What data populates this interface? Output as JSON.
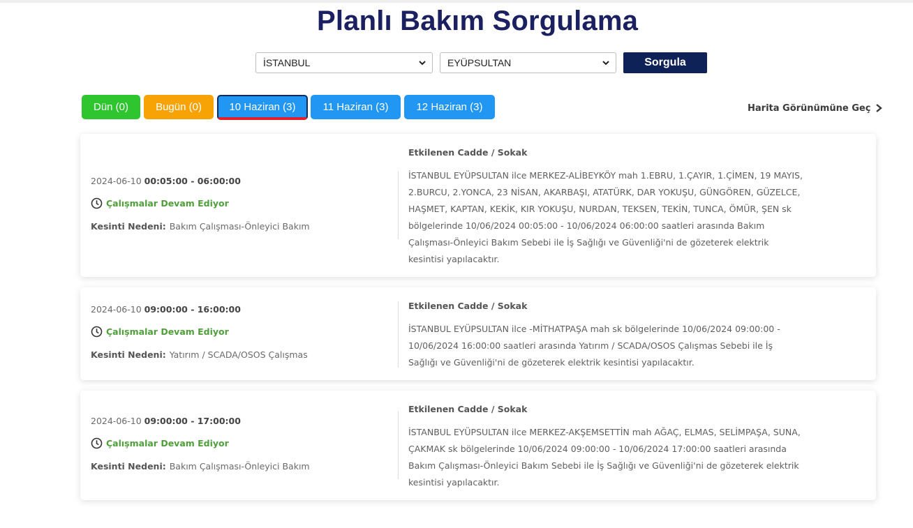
{
  "page": {
    "title": "Planlı Bakım Sorgulama"
  },
  "filters": {
    "city": "İSTANBUL",
    "district": "EYÜPSULTAN",
    "query_button": "Sorgula"
  },
  "tabs": [
    {
      "label": "Dün (0)"
    },
    {
      "label": "Bugün (0)"
    },
    {
      "label": "10 Haziran (3)"
    },
    {
      "label": "11 Haziran (3)"
    },
    {
      "label": "12 Haziran (3)"
    }
  ],
  "map_link": "Harita Görünümüne Geç",
  "outages": [
    {
      "date": "2024-06-10",
      "time_range": "00:05:00 - 06:00:00",
      "status": "Çalışmalar Devam Ediyor",
      "reason_label": "Kesinti Nedeni:",
      "reason": "Bakım Çalışması-Önleyici Bakım",
      "affected_label": "Etkilenen Cadde / Sokak",
      "affected_text": "İSTANBUL EYÜPSULTAN ilce MERKEZ-ALİBEYKÖY mah 1.EBRU, 1.ÇAYIR, 1.ÇİMEN, 19 MAYIS, 2.BURCU, 2.YONCA, 23 NİSAN, AKARBAŞI, ATATÜRK, DAR YOKUŞU, GÜNGÖREN, GÜZELCE, HAŞMET, KAPTAN, KEKİK, KIR YOKUŞU, NURDAN, TEKSEN, TEKİN, TUNCA, ÖMÜR, ŞEN sk bölgelerinde 10/06/2024 00:05:00 - 10/06/2024 06:00:00 saatleri arasında Bakım Çalışması-Önleyici Bakım Sebebi ile İş Sağlığı ve Güvenliği'ni de gözeterek elektrik kesintisi yapılacaktır."
    },
    {
      "date": "2024-06-10",
      "time_range": "09:00:00 - 16:00:00",
      "status": "Çalışmalar Devam Ediyor",
      "reason_label": "Kesinti Nedeni:",
      "reason": "Yatırım / SCADA/OSOS Çalışmas",
      "affected_label": "Etkilenen Cadde / Sokak",
      "affected_text": "İSTANBUL EYÜPSULTAN ilce -MİTHATPAŞA mah sk bölgelerinde 10/06/2024 09:00:00 - 10/06/2024 16:00:00 saatleri arasında Yatırım / SCADA/OSOS Çalışmas Sebebi ile İş Sağlığı ve Güvenliği'ni de gözeterek elektrik kesintisi yapılacaktır."
    },
    {
      "date": "2024-06-10",
      "time_range": "09:00:00 - 17:00:00",
      "status": "Çalışmalar Devam Ediyor",
      "reason_label": "Kesinti Nedeni:",
      "reason": "Bakım Çalışması-Önleyici Bakım",
      "affected_label": "Etkilenen Cadde / Sokak",
      "affected_text": "İSTANBUL EYÜPSULTAN ilce MERKEZ-AKŞEMSETTİN mah AĞAÇ, ELMAS, SELİMPAŞA, SUNA, ÇAKMAK sk bölgelerinde 10/06/2024 09:00:00 - 10/06/2024 17:00:00 saatleri arasında Bakım Çalışması-Önleyici Bakım Sebebi ile İş Sağlığı ve Güvenliği'ni de gözeterek elektrik kesintisi yapılacaktır."
    }
  ],
  "colors": {
    "title": "#1b2061",
    "query_button": "#0e2258",
    "tab_yesterday": "#2ec52e",
    "tab_today": "#f7a305",
    "tab_date": "#2196f3",
    "tab_active_underline": "#e0202a",
    "status": "#4fa03a"
  },
  "icons": {
    "select_arrow": "chevron-down-icon",
    "map_link": "chevron-right-icon",
    "status": "clock-icon"
  }
}
